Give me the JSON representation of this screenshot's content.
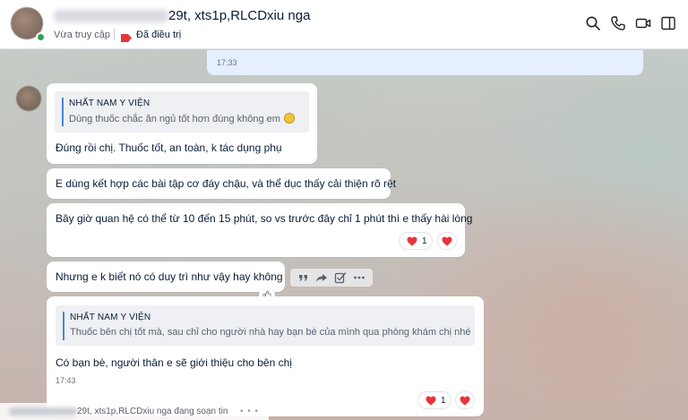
{
  "header": {
    "contact_name_suffix": "29t, xts1p,RLCDxiu nga",
    "status": "Vừa truy cập",
    "tag_label": "Đã điều trị",
    "tag_color": "#e8353b",
    "online_color": "#30a44b",
    "icons": [
      "search-icon",
      "phone-icon",
      "video-icon",
      "sidebar-toggle-icon"
    ]
  },
  "messages": {
    "outgoing_time": "17:33",
    "m1": {
      "quote_name": "NHẤT NAM Y VIỆN",
      "quote_text": "Dùng thuốc chắc ăn ngủ tốt hơn đúng không em",
      "text": "Đúng rồi chị. Thuốc tốt, an toàn, k tác dụng phụ"
    },
    "m2": {
      "text": "E dùng kết hợp các bài tập cơ đáy chậu, và thể dục thấy cải thiện rõ rệt"
    },
    "m3": {
      "text": "Bây giờ quan hệ có thể từ 10 đến 15 phút, so vs trước đây chỉ 1 phút thì e thấy hài lòng",
      "reaction_count": "1"
    },
    "m4": {
      "text": "Nhưng e k biết nó có duy trì như vậy hay không"
    },
    "m5": {
      "quote_name": "NHẤT NAM Y VIỆN",
      "quote_text": "Thuốc bên chị tốt mà, sau chỉ cho người nhà hay bạn bè của mình qua phòng khám chị nhé",
      "text": "Có bạn bè, người thân e sẽ giới thiệu cho bên chị",
      "time": "17:43",
      "reaction_count": "1"
    }
  },
  "typing_indicator": {
    "text": "29t, xts1p,RLCDxiu nga đang soạn tin",
    "dots": "• • •"
  },
  "colors": {
    "accent": "#4f83d6",
    "heart": "#e8353b",
    "outgoing_bubble": "#e5efff"
  }
}
